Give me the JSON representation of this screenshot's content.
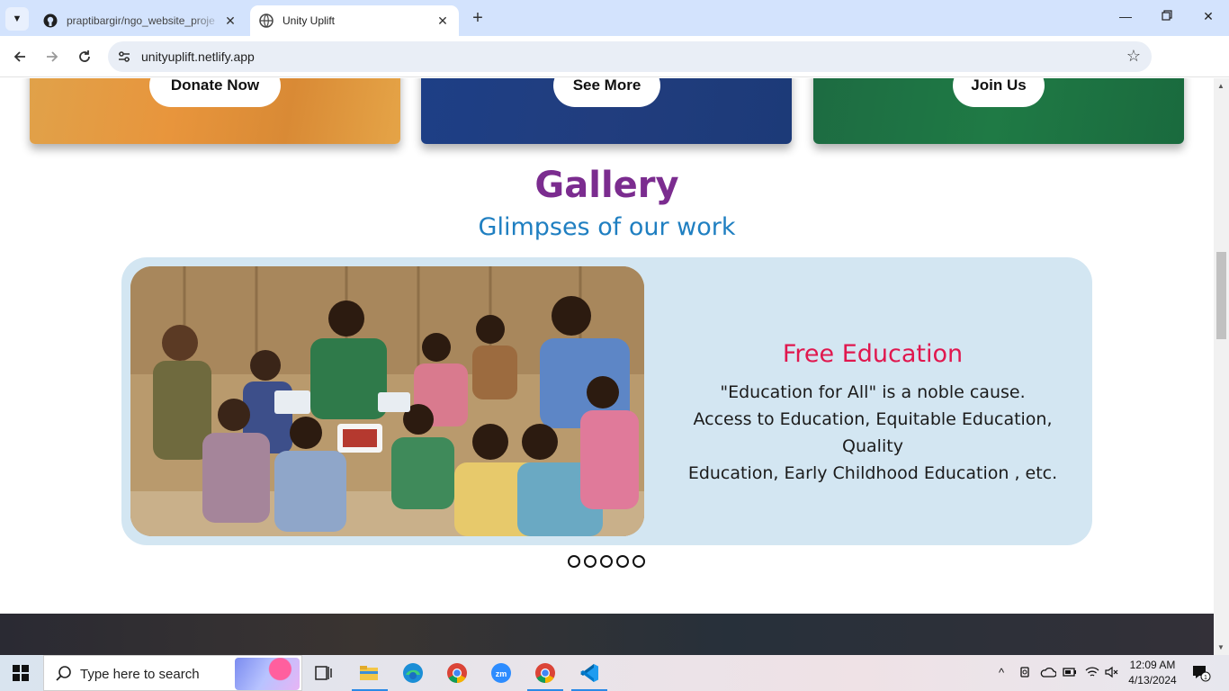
{
  "browser": {
    "tabs": [
      {
        "title": "praptibargir/ngo_website_proje",
        "active": false
      },
      {
        "title": "Unity Uplift",
        "active": true
      }
    ],
    "url": "unityuplift.netlify.app"
  },
  "page": {
    "cards": [
      {
        "button": "Donate Now",
        "color": "#e39a42"
      },
      {
        "button": "See More",
        "color": "#1f3e80"
      },
      {
        "button": "Join Us",
        "color": "#1d7343"
      }
    ],
    "gallery": {
      "title": "Gallery",
      "subtitle": "Glimpses of our work",
      "slide": {
        "title": "Free Education",
        "lines": [
          "\"Education for All\" is a noble cause.",
          "Access to Education, Equitable Education, Quality",
          "Education, Early Childhood Education , etc."
        ]
      },
      "dot_count": 5
    }
  },
  "taskbar": {
    "search_placeholder": "Type here to search",
    "time": "12:09 AM",
    "date": "4/13/2024",
    "notification_count": "1"
  }
}
